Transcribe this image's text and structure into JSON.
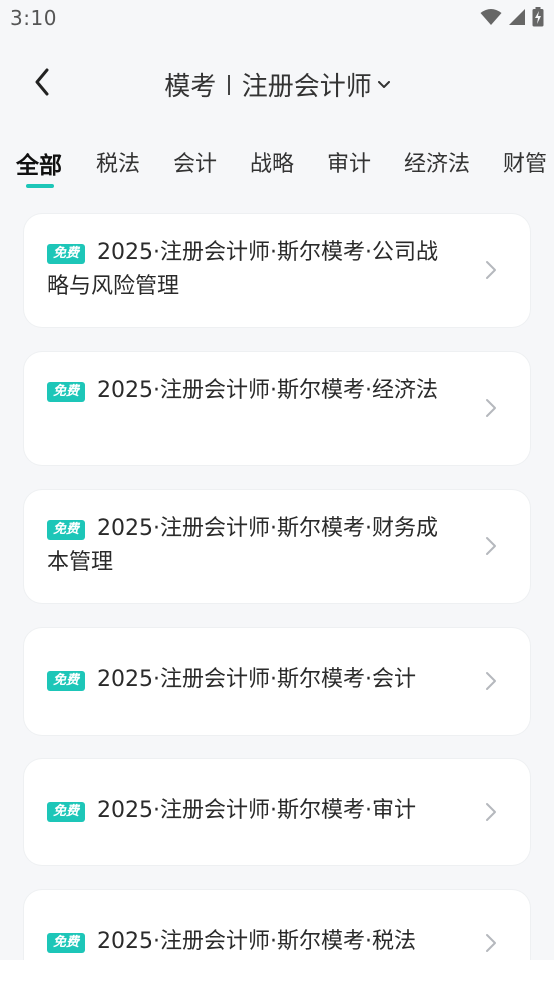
{
  "status_bar": {
    "time": "3:10",
    "icons": [
      "wifi-icon",
      "cellular-signal-icon",
      "battery-charging-icon"
    ]
  },
  "nav": {
    "back_icon": "chevron-left-icon",
    "title_left": "模考",
    "title_right": "注册会计师",
    "dropdown_icon": "chevron-down-icon"
  },
  "tabs": [
    {
      "label": "全部",
      "active": true
    },
    {
      "label": "税法",
      "active": false
    },
    {
      "label": "会计",
      "active": false
    },
    {
      "label": "战略",
      "active": false
    },
    {
      "label": "审计",
      "active": false
    },
    {
      "label": "经济法",
      "active": false
    },
    {
      "label": "财管",
      "active": false
    }
  ],
  "cards": [
    {
      "badge": "免费",
      "title": "2025·注册会计师·斯尔模考·公司战略与风险管理"
    },
    {
      "badge": "免费",
      "title": "2025·注册会计师·斯尔模考·经济法"
    },
    {
      "badge": "免费",
      "title": "2025·注册会计师·斯尔模考·财务成本管理"
    },
    {
      "badge": "免费",
      "title": "2025·注册会计师·斯尔模考·会计"
    },
    {
      "badge": "免费",
      "title": "2025·注册会计师·斯尔模考·审计"
    },
    {
      "badge": "免费",
      "title": "2025·注册会计师·斯尔模考·税法"
    }
  ],
  "colors": {
    "accent": "#1dc6b8",
    "background": "#f6f7f9",
    "card": "#ffffff"
  }
}
